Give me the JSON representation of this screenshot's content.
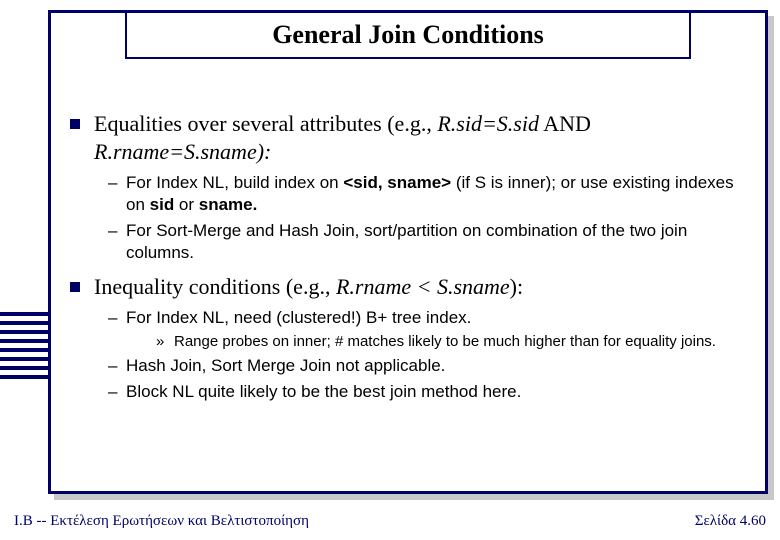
{
  "title": "General Join Conditions",
  "sections": [
    {
      "lead": "Equalities over several attributes (e.g., ",
      "cond_a": "R.sid=S.sid",
      "and": " AND ",
      "cond_b": "R.rname=S.sname",
      "tail": "):",
      "subs": [
        {
          "pre": "For Index NL, build index on ",
          "strong1": "<sid, sname>",
          "mid": " (if S is inner); or use existing indexes on ",
          "strong2": "sid",
          "mid2": " or ",
          "strong3": "sname.",
          "post": ""
        },
        {
          "pre": "For Sort-Merge and Hash Join, sort/partition on combination of the two join columns.",
          "strong1": "",
          "mid": "",
          "strong2": "",
          "mid2": "",
          "strong3": "",
          "post": ""
        }
      ]
    },
    {
      "lead": "Inequality conditions (e.g., ",
      "cond_a": "R.rname < S.sname",
      "and": "",
      "cond_b": "",
      "tail": "):",
      "subs": [
        {
          "pre": "For Index NL, need (clustered!) B+ tree index.",
          "strong1": "",
          "mid": "",
          "strong2": "",
          "mid2": "",
          "strong3": "",
          "post": "",
          "subsub": "Range probes on inner; # matches likely to be much higher than for equality joins."
        },
        {
          "pre": "Hash Join, Sort Merge Join not applicable.",
          "strong1": "",
          "mid": "",
          "strong2": "",
          "mid2": "",
          "strong3": "",
          "post": ""
        },
        {
          "pre": "Block NL quite likely to be the best join method here.",
          "strong1": "",
          "mid": "",
          "strong2": "",
          "mid2": "",
          "strong3": "",
          "post": ""
        }
      ]
    }
  ],
  "footer": {
    "left": "I.B -- Εκτέλεση Ερωτήσεων και Βελτιστοποίηση",
    "right_label": "Σελίδα ",
    "right_page": "4.60"
  }
}
